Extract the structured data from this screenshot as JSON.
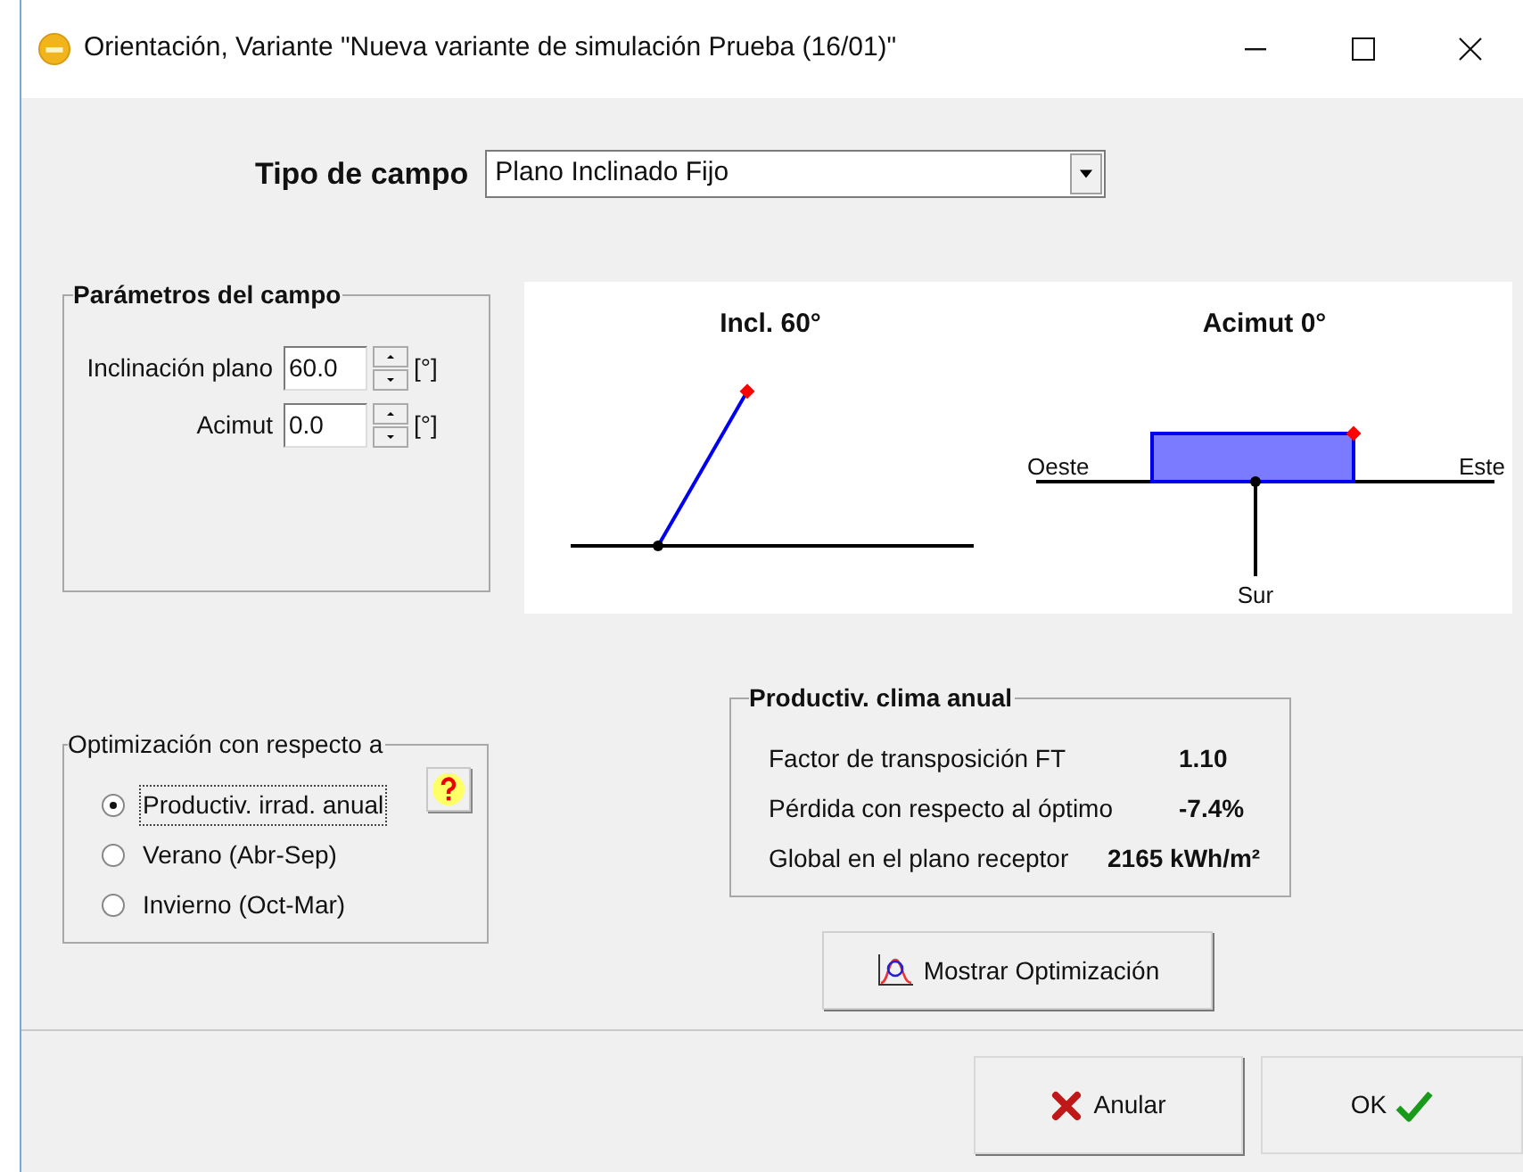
{
  "window": {
    "title": "Orientación, Variante \"Nueva variante de simulación Prueba (16/01)\""
  },
  "field_type": {
    "label": "Tipo de campo",
    "value": "Plano Inclinado Fijo"
  },
  "parameters": {
    "title": "Parámetros del campo",
    "fields": [
      {
        "label": "Inclinación plano",
        "value": "60.0",
        "unit": "[°]"
      },
      {
        "label": "Acimut",
        "value": "0.0",
        "unit": "[°]"
      }
    ]
  },
  "diagram": {
    "tilt_title": "Incl. 60°",
    "azimuth_title": "Acimut 0°",
    "west": "Oeste",
    "east": "Este",
    "south": "Sur"
  },
  "optimization": {
    "title": "Optimización con respecto a",
    "options": [
      {
        "label": "Productiv. irrad. anual",
        "selected": true
      },
      {
        "label": "Verano (Abr-Sep)",
        "selected": false
      },
      {
        "label": "Invierno (Oct-Mar)",
        "selected": false
      }
    ]
  },
  "results": {
    "title": "Productiv. clima anual",
    "rows": [
      {
        "label": "Factor de transposición FT",
        "value": "1.10"
      },
      {
        "label": "Pérdida con respecto al óptimo",
        "value": "-7.4%"
      },
      {
        "label": "Global en el plano receptor",
        "value": "2165 kWh/m²"
      }
    ]
  },
  "buttons": {
    "show_optimization": "Mostrar Optimización",
    "cancel": "Anular",
    "ok": "OK"
  }
}
